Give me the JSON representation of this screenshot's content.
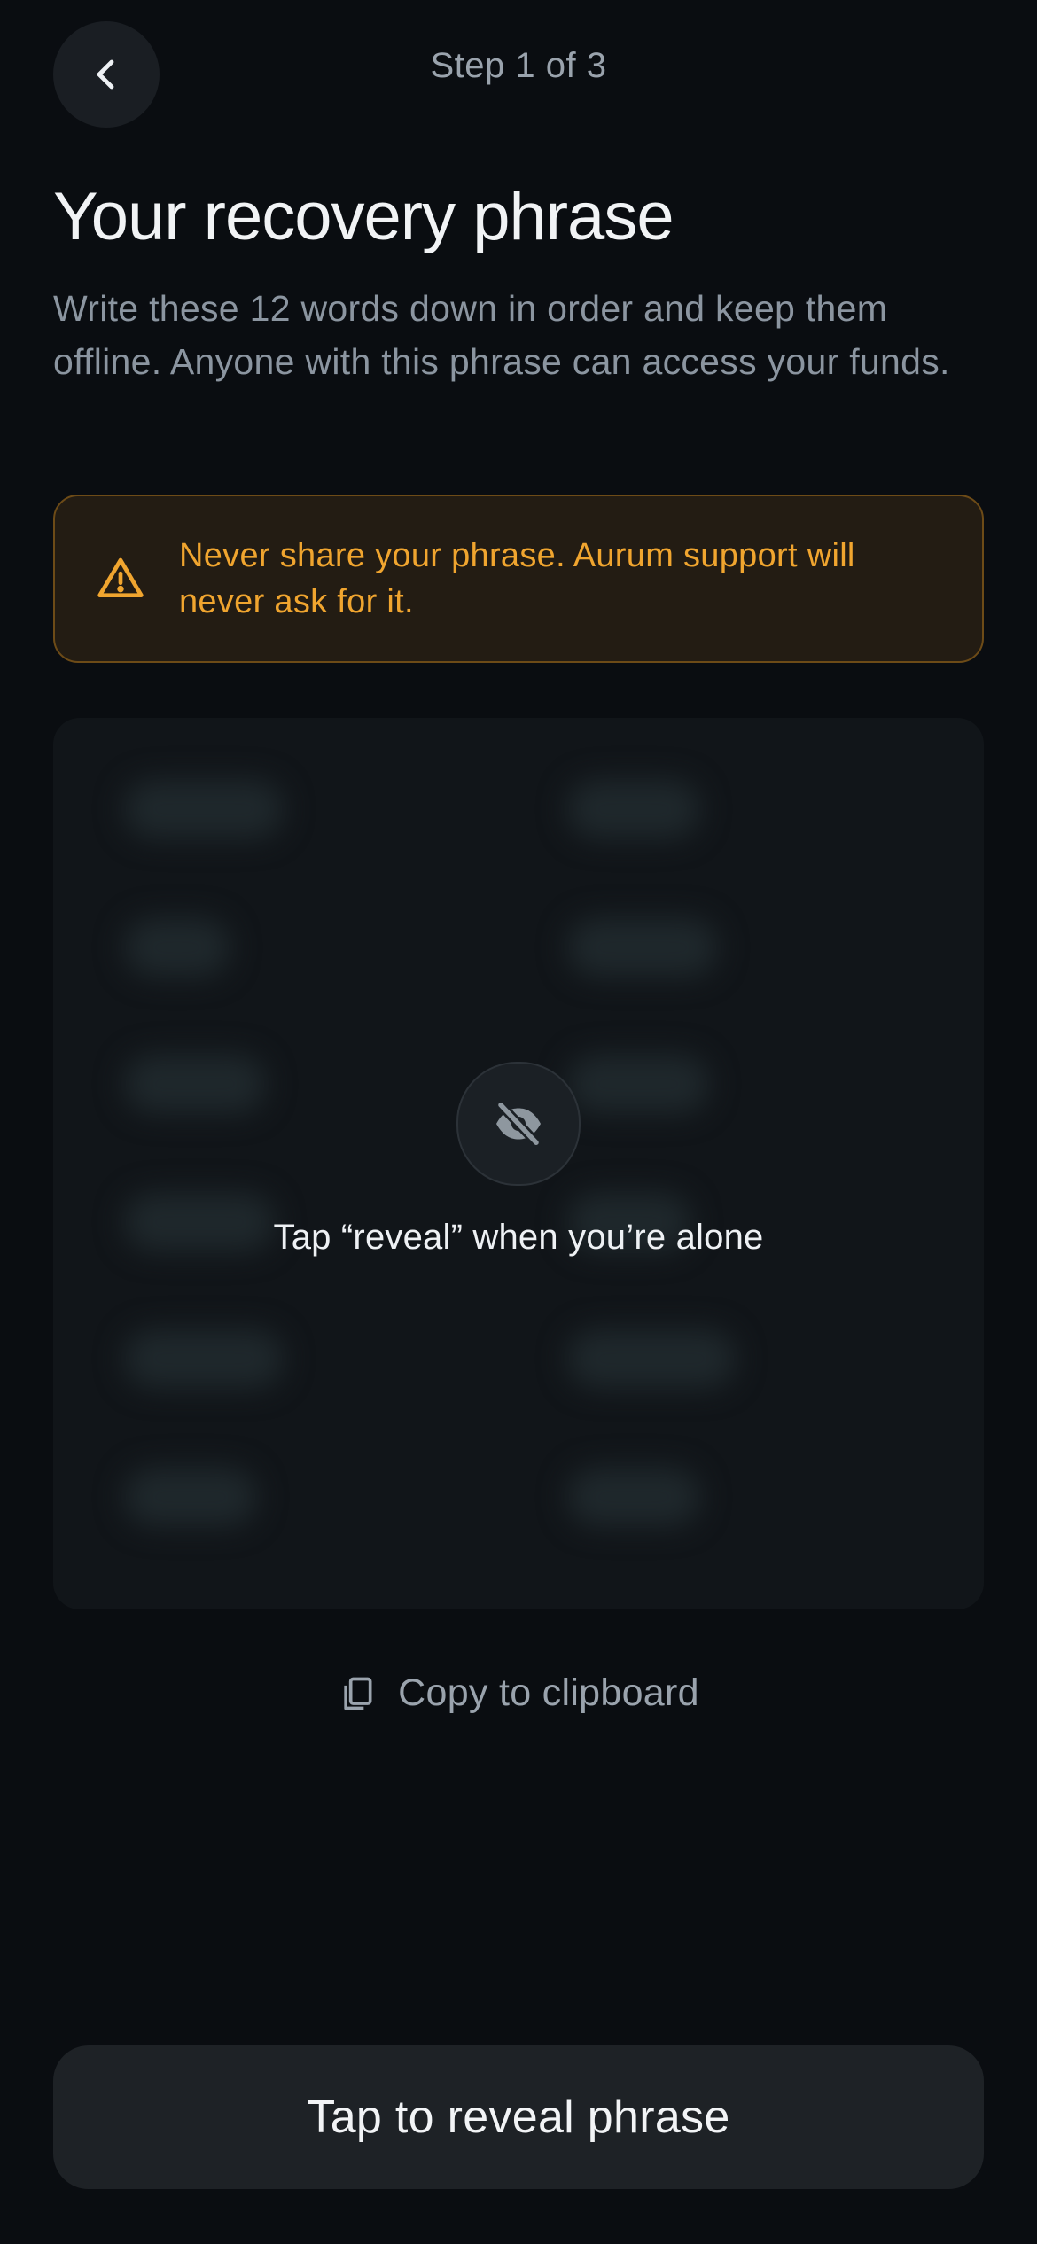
{
  "header": {
    "back_icon": "chevron-left-icon",
    "step_label": "Step 1 of 3"
  },
  "intro": {
    "title": "Your recovery phrase",
    "description": "Write these 12 words down in order and keep them offline. Anyone with this phrase can access your funds."
  },
  "warning": {
    "icon": "warning-triangle-icon",
    "text": "Never share your phrase. Aurum support will never ask for it."
  },
  "phrase_card": {
    "word_count": 12,
    "hidden_icon": "eye-off-icon",
    "hint": "Tap “reveal” when you’re alone"
  },
  "copy": {
    "icon": "copy-icon",
    "label": "Copy to clipboard"
  },
  "primary_action": {
    "label": "Tap to reveal phrase"
  },
  "colors": {
    "background": "#0a0d11",
    "warning_accent": "#f0a52f",
    "muted_text": "#8b95a0"
  }
}
